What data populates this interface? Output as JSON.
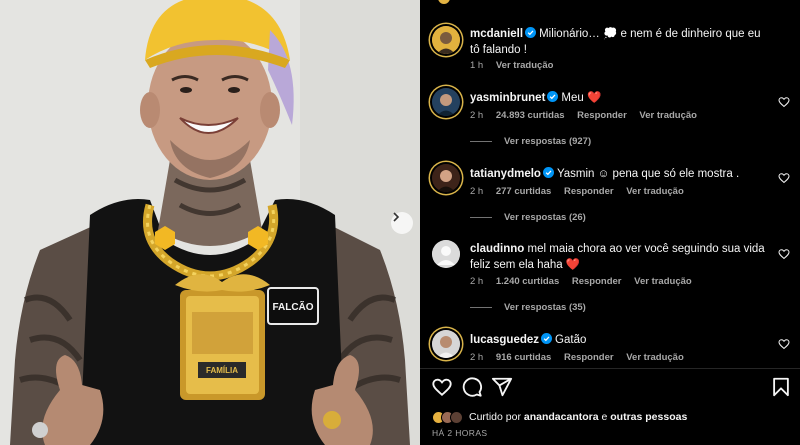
{
  "post": {
    "caption": {
      "username": "mcdaniell",
      "verified": true,
      "text": "Milionário… 💭 e nem é de dinheiro que eu tô falando !",
      "time": "1 h",
      "translate": "Ver tradução"
    }
  },
  "photo_text": {
    "chain_badge": "FALCÃO",
    "pendant": "FAMÍLIA"
  },
  "comments": [
    {
      "username": "yasminbrunet",
      "verified": true,
      "text": "Meu",
      "emoji": "❤️",
      "time": "2 h",
      "likes": "24.893 curtidas",
      "reply": "Responder",
      "translate": "Ver tradução",
      "view_replies": "Ver respostas (927)"
    },
    {
      "username": "tatianydmelo",
      "verified": true,
      "text": "Yasmin ☺ pena que só ele mostra .",
      "time": "2 h",
      "likes": "277 curtidas",
      "reply": "Responder",
      "translate": "Ver tradução",
      "view_replies": "Ver respostas (26)"
    },
    {
      "username": "claudinno",
      "verified": false,
      "text": "mel maia chora ao ver você seguindo sua vida feliz sem ela haha",
      "emoji": "❤️",
      "time": "2 h",
      "likes": "1.240 curtidas",
      "reply": "Responder",
      "translate": "Ver tradução",
      "view_replies": "Ver respostas (35)"
    },
    {
      "username": "lucasguedez",
      "verified": true,
      "text": "Gatão",
      "time": "2 h",
      "likes": "916 curtidas",
      "reply": "Responder",
      "translate": "Ver tradução"
    }
  ],
  "actions": {
    "icons": [
      "heart-icon",
      "comment-icon",
      "share-icon",
      "bookmark-icon"
    ]
  },
  "liked_by": {
    "prefix": "Curtido por",
    "user": "anandacantora",
    "conj": "e",
    "others": "outras pessoas"
  },
  "time_ago": "HÁ 2 HORAS",
  "colors": {
    "background": "#000000",
    "text": "#f5f5f5",
    "secondary_text": "#a8a8a8",
    "verified": "#0095f6",
    "heart": "#ff3040",
    "cap_yellow": "#f2c230"
  }
}
